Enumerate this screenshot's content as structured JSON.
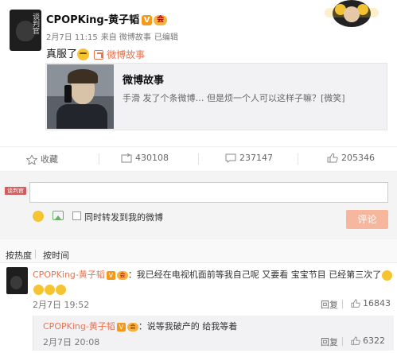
{
  "post": {
    "avatar_text": "谈判官",
    "username": "CPOPKing-黄子韬",
    "verified_badge": "V",
    "member_badge": "会",
    "date": "2月7日 11:15",
    "via": "来自 微博故事",
    "edited": "已编辑",
    "text": "真服了",
    "link_label": "微博故事"
  },
  "card": {
    "title": "微博故事",
    "description": "手滑 发了个条微博… 但是烦一个人可以这样子嘛？[微笑]"
  },
  "actions": {
    "favorite": "收藏",
    "repost": "430108",
    "comment": "237147",
    "like": "205346"
  },
  "composer": {
    "avatar_text": "谈判官",
    "repost_checkbox_label": "同时转发到我的微博",
    "submit_label": "评论"
  },
  "sort": {
    "by_hot": "按热度",
    "by_time": "按时间"
  },
  "comments": [
    {
      "username": "CPOPKing-黄子韬",
      "text": "：我已经在电视机面前等我自己呢 又要看 宝宝节目 已经第三次了",
      "time": "2月7日 19:52",
      "reply_label": "回复",
      "likes": "16843",
      "sub_reply": {
        "username": "CPOPKing-黄子韬",
        "text": "：说等我破产的 给我等着",
        "time": "2月7日 20:08",
        "reply_label": "回复",
        "likes": "6322"
      }
    }
  ],
  "colors": {
    "accent": "#eb7350",
    "badge": "#f39a1d",
    "submit_disabled": "#f7b79e"
  }
}
